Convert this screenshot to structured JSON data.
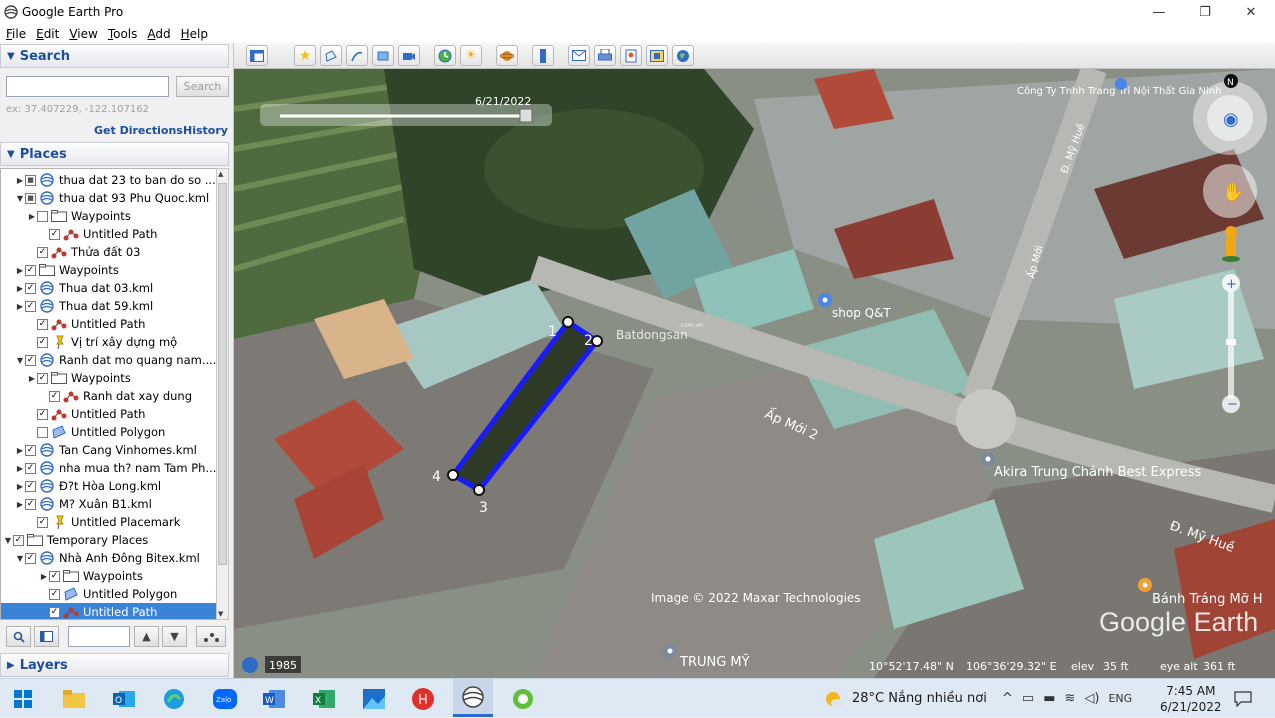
{
  "window": {
    "title": "Google Earth Pro",
    "minimize": "—",
    "restore": "❐",
    "close": "✕"
  },
  "menu": [
    "File",
    "Edit",
    "View",
    "Tools",
    "Add",
    "Help"
  ],
  "search": {
    "header": "Search",
    "input_value": "",
    "button": "Search",
    "hint": "ex: 37.407229, -122.107162",
    "get_directions": "Get Directions",
    "history": "History"
  },
  "places": {
    "header": "Places",
    "items": [
      {
        "label": "thua dat 23 to ban do so ...",
        "icon": "kml-globe-icon",
        "check": "partial",
        "twist": "closed"
      },
      {
        "label": "thua dat 93 Phu Quoc.kml",
        "icon": "kml-globe-icon",
        "check": "partial",
        "twist": "open"
      },
      {
        "label": "Waypoints",
        "icon": "folder-icon",
        "check": "none",
        "twist": "closed"
      },
      {
        "label": "Untitled Path",
        "icon": "path-icon",
        "check": "checked",
        "twist": ""
      },
      {
        "label": "Thửa đất 03",
        "icon": "path-icon",
        "check": "checked",
        "twist": ""
      },
      {
        "label": "Waypoints",
        "icon": "folder-icon",
        "check": "checked",
        "twist": "closed"
      },
      {
        "label": "Thua dat 03.kml",
        "icon": "kml-globe-icon",
        "check": "checked",
        "twist": "closed"
      },
      {
        "label": "Thua dat 59.kml",
        "icon": "kml-globe-icon",
        "check": "checked",
        "twist": "closed"
      },
      {
        "label": "Untitled Path",
        "icon": "path-icon",
        "check": "checked",
        "twist": ""
      },
      {
        "label": "Vị trí xây dựng mộ",
        "icon": "pushpin-icon",
        "check": "checked",
        "twist": ""
      },
      {
        "label": "Ranh dat mo quang nam....",
        "icon": "kml-globe-icon",
        "check": "checked",
        "twist": "open"
      },
      {
        "label": "Waypoints",
        "icon": "folder-icon",
        "check": "checked",
        "twist": "closed"
      },
      {
        "label": "Ranh dat xay dung",
        "icon": "path-icon",
        "check": "checked",
        "twist": ""
      },
      {
        "label": "Untitled Path",
        "icon": "path-icon",
        "check": "checked",
        "twist": ""
      },
      {
        "label": "Untitled Polygon",
        "icon": "polygon-icon",
        "check": "none",
        "twist": ""
      },
      {
        "label": "Tan Cang Vinhomes.kml",
        "icon": "kml-globe-icon",
        "check": "checked",
        "twist": "closed"
      },
      {
        "label": "nha mua th? nam Tam Ph...",
        "icon": "kml-globe-icon",
        "check": "checked",
        "twist": "closed"
      },
      {
        "label": "Đ?t Hòa Long.kml",
        "icon": "kml-globe-icon",
        "check": "checked",
        "twist": "closed"
      },
      {
        "label": "M? Xuân B1.kml",
        "icon": "kml-globe-icon",
        "check": "checked",
        "twist": "closed"
      },
      {
        "label": "Untitled Placemark",
        "icon": "pushpin-icon",
        "check": "checked",
        "twist": ""
      },
      {
        "label": "Temporary Places",
        "icon": "folder-icon",
        "check": "checked",
        "twist": "open"
      },
      {
        "label": "Nhà Anh Đông Bitex.kml",
        "icon": "kml-globe-icon",
        "check": "checked",
        "twist": "open"
      },
      {
        "label": "Waypoints",
        "icon": "folder-icon",
        "check": "checked",
        "twist": "closed"
      },
      {
        "label": "Untitled Polygon",
        "icon": "polygon-icon",
        "check": "checked",
        "twist": ""
      },
      {
        "label": "Untitled Path",
        "icon": "path-icon",
        "check": "checked",
        "twist": ""
      }
    ],
    "selected_index": 24
  },
  "layers": {
    "header": "Layers"
  },
  "map": {
    "date": "6/21/2022",
    "imagery_year": "1985",
    "copyright": "Image © 2022 Maxar Technologies",
    "brand": "Google Earth",
    "status": {
      "lat": "10°52'17.48\" N",
      "lon": "106°36'29.32\" E",
      "elev_label": "elev",
      "elev_value": "35 ft",
      "eyealt_label": "eye alt",
      "eyealt_value": "361 ft"
    },
    "labels": {
      "company": "Công Ty Tnhh Trang Trí Nội Thất Gia Ninh",
      "shop": "shop Q&T",
      "road1": "Ấp Mới 2",
      "akira": "Akira Trung Chánh Best Express",
      "road2": "Đ. Mỹ Huề",
      "banh": "Bánh Tráng Mỡ H",
      "trungmy": "TRUNG MỸ",
      "road3": "Đ. Mỹ Huề",
      "road4": "Ấp Mới"
    },
    "watermark": "Batdongsan",
    "watermark_sub": ".com.vn",
    "polygon_points": [
      "1",
      "2",
      "3",
      "4"
    ],
    "polygon_color": "#1a1aff"
  },
  "taskbar": {
    "weather": "28°C  Nắng nhiều nơi",
    "lang": "ENG",
    "time": "7:45 AM",
    "date": "6/21/2022"
  }
}
